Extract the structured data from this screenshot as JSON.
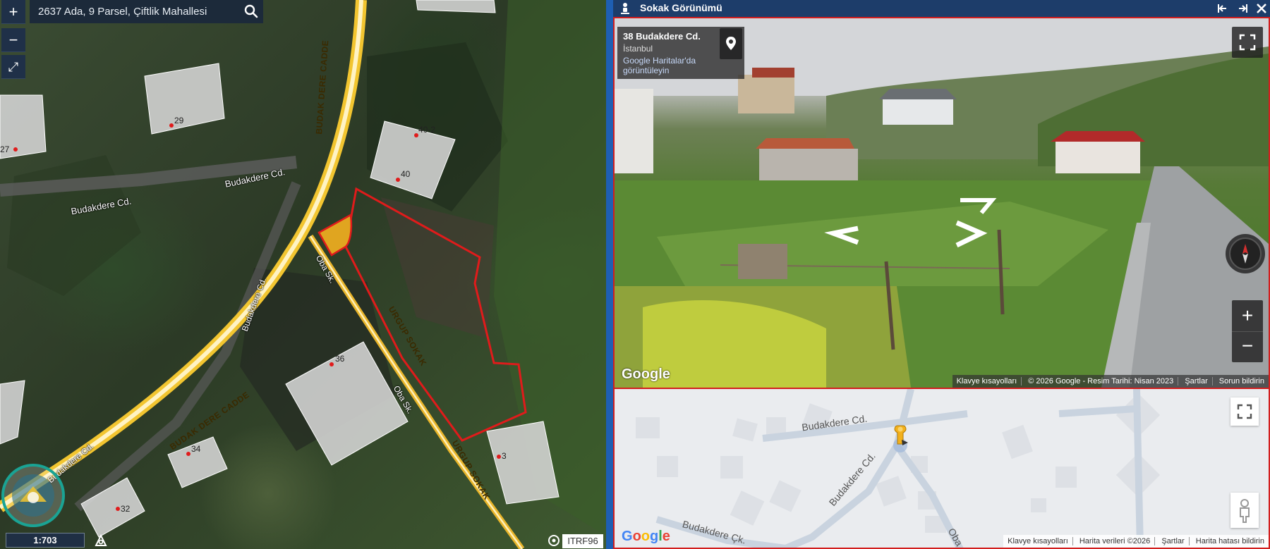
{
  "left_map": {
    "search_text": "2637 Ada, 9 Parsel, Çiftlik Mahallesi",
    "zoom_in": "+",
    "zoom_out": "−",
    "fullscreen": "⤢",
    "scale": "1:703",
    "crs": "ITRF96",
    "road_labels": {
      "budak_dere_cadde_top": "BUDAK DERE CADDE",
      "budak_dere_cadde_bottom": "BUDAK DERE CADDE",
      "budakdere_cd_1": "Budakdere Cd.",
      "budakdere_cd_2": "Budakdere Cd.",
      "budakdere_cd_3": "Budakdere Cd.",
      "budakdere_cd_4": "Budakdere Cd.",
      "oba_sk_1": "Oba Sk.",
      "oba_sk_2": "Oba Sk.",
      "urgup_sokak_1": "URGUP SOKAK",
      "urgup_sokak_2": "URGUP SOKAK"
    },
    "building_numbers": {
      "b27": "27",
      "b29": "29",
      "b40_2": "40-2",
      "b40": "40",
      "b36": "36",
      "b34": "34",
      "b32": "32",
      "b3": "3"
    },
    "parcel_color": "#e01b1b",
    "road_color": "#f2c530"
  },
  "street_view": {
    "header_title": "Sokak Görünümü",
    "address": "38 Budakdere Cd.",
    "city": "İstanbul",
    "maps_link": "Google Haritalar'da görüntüleyin",
    "google_logo": "Google",
    "footer": {
      "keyboard": "Klavye kısayolları",
      "copyright": "© 2026 Google - Resim Tarihi: Nisan 2023",
      "terms": "Şartlar",
      "report": "Sorun bildirin"
    },
    "zoom_in": "+",
    "zoom_out": "−",
    "accent_color": "#d21e1e"
  },
  "mini_map": {
    "labels": {
      "budakdere_cd_h": "Budakdere Cd.",
      "budakdere_cd_diag": "Budakdere Cd.",
      "budakdere_ck": "Budakdere Çk.",
      "oba": "Oba"
    },
    "google_logo": "Google",
    "footer": {
      "keyboard": "Klavye kısayolları",
      "map_data": "Harita verileri ©2026",
      "terms": "Şartlar",
      "report": "Harita hatası bildirin"
    }
  }
}
